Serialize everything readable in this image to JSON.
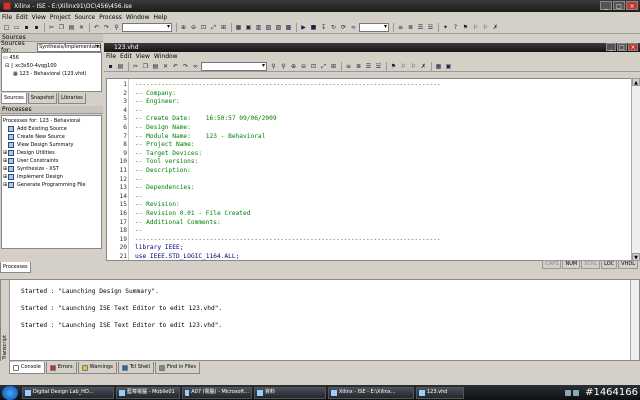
{
  "window": {
    "title": "Xilinx - ISE - E:\\Xilinx91\\OC\\456\\456.ise",
    "buttons": [
      "_",
      "□",
      "×"
    ]
  },
  "menubar": [
    "File",
    "Edit",
    "View",
    "Project",
    "Source",
    "Process",
    "Window",
    "Help"
  ],
  "sources_panel": {
    "title": "Sources",
    "sources_for_label": "Sources for:",
    "sources_for_value": "Synthesis/Implementatio",
    "tree": [
      "456",
      "xc3s50-4vqg100",
      "123 - Behavioral (123.vhd)"
    ],
    "tabs": [
      "Sources",
      "Snapshot",
      "Libraries"
    ]
  },
  "processes_panel": {
    "title": "Processes",
    "header": "Processes for: 123 - Behavioral",
    "items": [
      {
        "label": "Add Existing Source",
        "expandable": false
      },
      {
        "label": "Create New Source",
        "expandable": false
      },
      {
        "label": "View Design Summary",
        "expandable": false
      },
      {
        "label": "Design Utilities",
        "expandable": true
      },
      {
        "label": "User Constraints",
        "expandable": true
      },
      {
        "label": "Synthesize - XST",
        "expandable": true
      },
      {
        "label": "Implement Design",
        "expandable": true
      },
      {
        "label": "Generate Programming File",
        "expandable": true
      }
    ],
    "tab": "Processes"
  },
  "editor": {
    "title": "123.vhd",
    "menu": [
      "File",
      "Edit",
      "View",
      "Window"
    ],
    "lines": [
      {
        "n": "1",
        "text": "----------------------------------------------------------------------------------",
        "cls": "cm"
      },
      {
        "n": "2",
        "text": "-- Company:",
        "cls": "cm"
      },
      {
        "n": "3",
        "text": "-- Engineer:",
        "cls": "cm"
      },
      {
        "n": "4",
        "text": "--",
        "cls": "cm"
      },
      {
        "n": "5",
        "text": "-- Create Date:    16:50:57 09/06/2009",
        "cls": "cm"
      },
      {
        "n": "6",
        "text": "-- Design Name:",
        "cls": "cm"
      },
      {
        "n": "7",
        "text": "-- Module Name:    123 - Behavioral",
        "cls": "cm"
      },
      {
        "n": "8",
        "text": "-- Project Name:",
        "cls": "cm"
      },
      {
        "n": "9",
        "text": "-- Target Devices:",
        "cls": "cm"
      },
      {
        "n": "10",
        "text": "-- Tool versions:",
        "cls": "cm"
      },
      {
        "n": "11",
        "text": "-- Description:",
        "cls": "cm"
      },
      {
        "n": "12",
        "text": "--",
        "cls": "cm"
      },
      {
        "n": "13",
        "text": "-- Dependencies:",
        "cls": "cm"
      },
      {
        "n": "14",
        "text": "--",
        "cls": "cm"
      },
      {
        "n": "15",
        "text": "-- Revision:",
        "cls": "cm"
      },
      {
        "n": "16",
        "text": "-- Revision 0.01 - File Created",
        "cls": "cm"
      },
      {
        "n": "17",
        "text": "-- Additional Comments:",
        "cls": "cm"
      },
      {
        "n": "18",
        "text": "--",
        "cls": "cm"
      },
      {
        "n": "19",
        "text": "----------------------------------------------------------------------------------",
        "cls": "cm"
      },
      {
        "n": "20",
        "text": "library IEEE;",
        "cls": "kw"
      },
      {
        "n": "21",
        "text": "use IEEE.STD_LOGIC_1164.ALL;",
        "cls": "kw"
      }
    ],
    "status": [
      {
        "label": "CAPS",
        "on": false
      },
      {
        "label": "NUM",
        "on": true
      },
      {
        "label": "SCRL",
        "on": false
      },
      {
        "label": "LOC",
        "on": true
      },
      {
        "label": "VHDL",
        "on": true
      }
    ]
  },
  "console": {
    "side_label": "Transcript",
    "lines": [
      "Started : \"Launching Design Summary\".",
      "",
      "Started : \"Launching ISE Text Editor to edit 123.vhd\".",
      "",
      "Started : \"Launching ISE Text Editor to edit 123.vhd\"."
    ],
    "tabs": [
      {
        "label": "Console",
        "color": "#ffffff"
      },
      {
        "label": "Errors",
        "color": "#d03020"
      },
      {
        "label": "Warnings",
        "color": "#e8c020"
      },
      {
        "label": "Tcl Shell",
        "color": "#3060c0"
      },
      {
        "label": "Find in Files",
        "color": "#888888"
      }
    ]
  },
  "taskbar": {
    "items": [
      "Digital Design Lab_HD...",
      "藍莓電腦 - Mobile01",
      "A07 (電腦) - Microsoft...",
      "資料",
      "Xilinx - ISE - E:\\Xilinx...",
      "123.vhd"
    ],
    "watermark": "#1464166"
  }
}
